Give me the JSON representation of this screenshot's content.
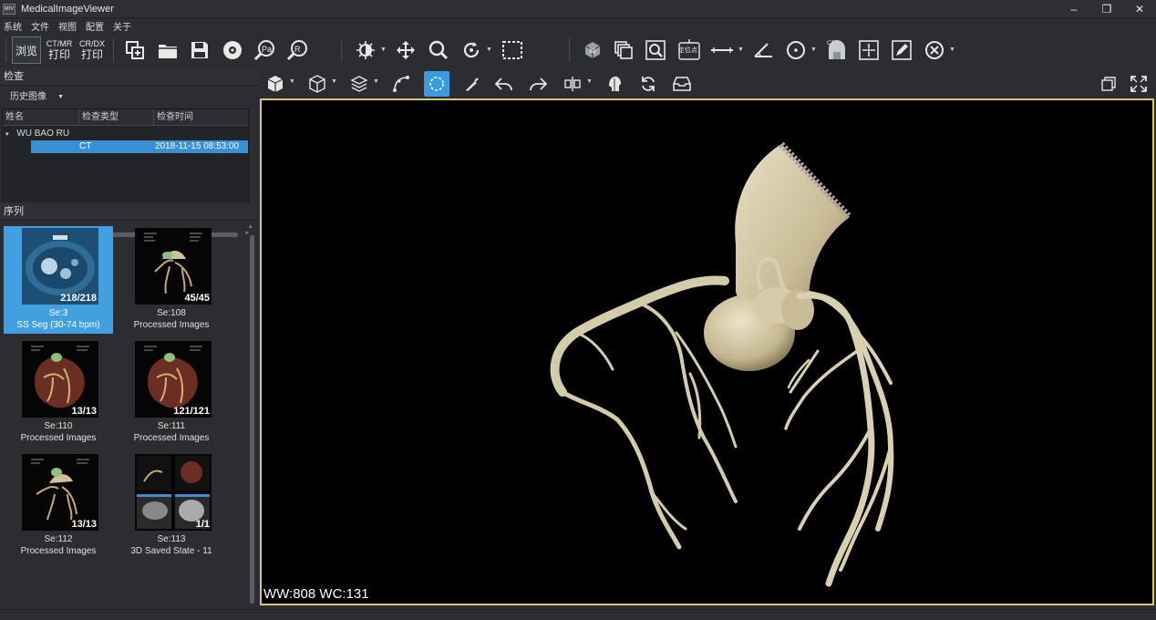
{
  "window": {
    "title": "MedicalImageViewer",
    "icon_text": "MIV",
    "minimize": "‒",
    "restore": "❐",
    "close": "✕"
  },
  "menu": [
    "系统",
    "文件",
    "视图",
    "配置",
    "关于"
  ],
  "toolbar": {
    "browse_label": "浏览",
    "ctmr_top": "CT/MR",
    "ctmr_bottom": "打印",
    "crdx_top": "CR/DX",
    "crdx_bottom": "打印",
    "locate_label": "定位点",
    "icons": [
      "import-icon",
      "open-folder-icon",
      "save-icon",
      "disc-icon",
      "pan-zoom-icon",
      "search-zoom-icon",
      "brightness-icon",
      "move-icon",
      "magnify-icon",
      "rotate-icon",
      "crop-rect-icon",
      "cube-3d-icon",
      "stack-icon",
      "fit-window-icon",
      "locate-point-icon",
      "ruler-icon",
      "angle-icon",
      "circle-icon",
      "ct-icon",
      "center-point-icon",
      "pen-icon",
      "cancel-icon"
    ]
  },
  "check_panel": {
    "heading": "检查",
    "combo_value": "历史图像",
    "columns": [
      "姓名",
      "检查类型",
      "检查时间"
    ],
    "patient_name": "WU BAO RU",
    "study_type": "CT",
    "study_time": "2018-11-15 08:53:00"
  },
  "series_panel": {
    "heading": "序列",
    "items": [
      {
        "count": "218/218",
        "se": "Se:3",
        "desc": "SS Seg (30-74 bpm)"
      },
      {
        "count": "45/45",
        "se": "Se:108",
        "desc": "Processed Images"
      },
      {
        "count": "13/13",
        "se": "Se:110",
        "desc": "Processed Images"
      },
      {
        "count": "121/121",
        "se": "Se:111",
        "desc": "Processed Images"
      },
      {
        "count": "13/13",
        "se": "Se:112",
        "desc": "Processed Images"
      },
      {
        "count": "1/1",
        "se": "Se:113",
        "desc": "3D Saved State - 11"
      }
    ]
  },
  "viewer": {
    "window_level": "WW:808 WC:131"
  },
  "colors": {
    "accent": "#3b9be0",
    "selection": "#42a0e0",
    "viewport_border": "#d8c86a",
    "vessel": "#d9d0b0"
  }
}
